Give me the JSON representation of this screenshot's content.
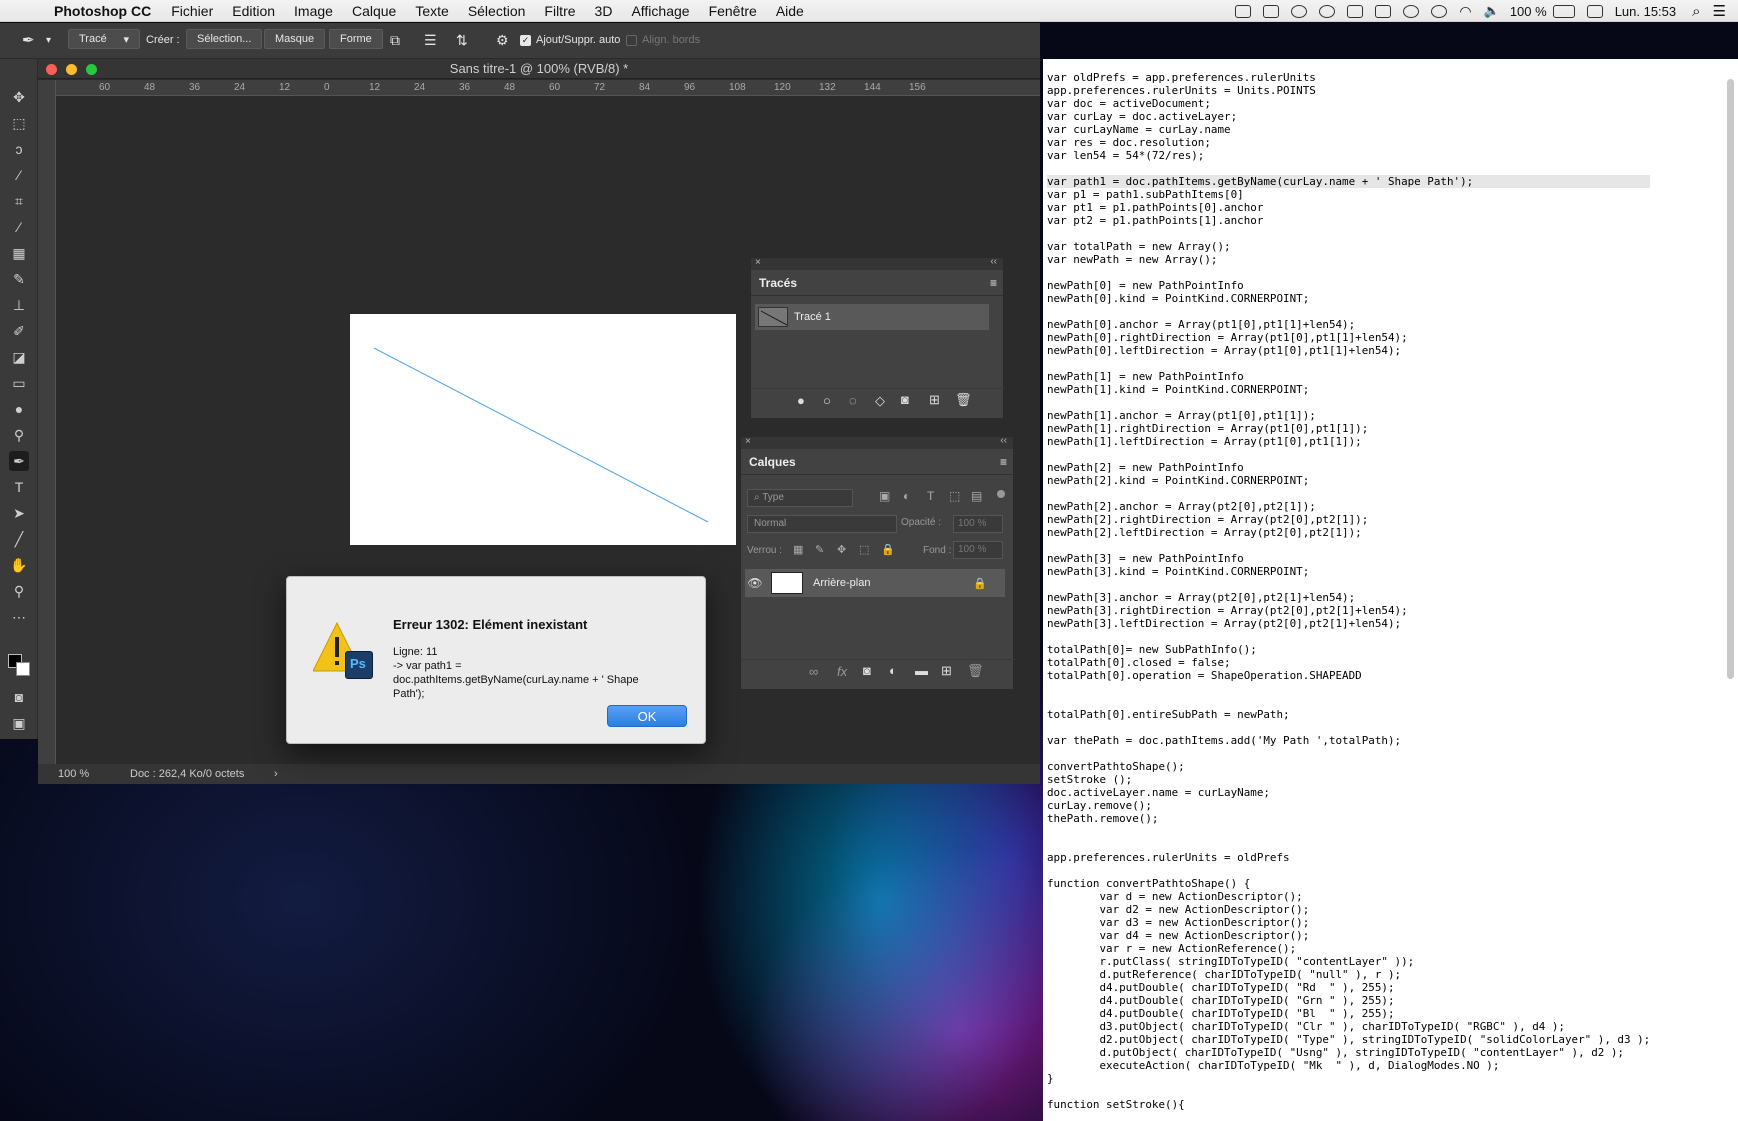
{
  "menubar": {
    "app_name": "Photoshop CC",
    "items": [
      "Fichier",
      "Edition",
      "Image",
      "Calque",
      "Texte",
      "Sélection",
      "Filtre",
      "3D",
      "Affichage",
      "Fenêtre",
      "Aide"
    ],
    "battery": "100 %",
    "clock": "Lun. 15:53"
  },
  "options_bar": {
    "mode_select": "Tracé",
    "create_label": "Créer :",
    "selection_btn": "Sélection...",
    "mask_btn": "Masque",
    "shape_btn": "Forme",
    "auto_add_label": "Ajout/Suppr. auto",
    "align_edges_label": "Align. bords"
  },
  "document": {
    "title": "Sans titre-1 @ 100% (RVB/8) *",
    "ruler_ticks": [
      "60",
      "48",
      "36",
      "24",
      "12",
      "0",
      "12",
      "24",
      "36",
      "48",
      "60",
      "72",
      "84",
      "96",
      "108",
      "120",
      "132",
      "144",
      "156"
    ],
    "status_zoom": "100 %",
    "status_doc": "Doc : 262,4 Ko/0 octets"
  },
  "paths_panel": {
    "title": "Tracés",
    "items": [
      {
        "name": "Tracé 1"
      }
    ]
  },
  "layers_panel": {
    "title": "Calques",
    "filter_placeholder": "Type",
    "blend_mode": "Normal",
    "opacity_label": "Opacité :",
    "opacity_value": "100 %",
    "lock_label": "Verrou :",
    "fill_label": "Fond :",
    "fill_value": "100 %",
    "layers": [
      {
        "name": "Arrière-plan"
      }
    ]
  },
  "dialog": {
    "title": "Erreur 1302: Elément inexistant",
    "line": "Ligne: 11",
    "message1": "-> var path1 =",
    "message2": "doc.pathItems.getByName(curLay.name + ' Shape",
    "message3": "Path');",
    "ok_label": "OK"
  },
  "editor": {
    "code_lines": [
      "var oldPrefs = app.preferences.rulerUnits",
      "app.preferences.rulerUnits = Units.POINTS",
      "var doc = activeDocument;",
      "var curLay = doc.activeLayer;",
      "var curLayName = curLay.name",
      "var res = doc.resolution;",
      "var len54 = 54*(72/res);",
      "",
      "var path1 = doc.pathItems.getByName(curLay.name + ' Shape Path');",
      "var p1 = path1.subPathItems[0]",
      "var pt1 = p1.pathPoints[0].anchor",
      "var pt2 = p1.pathPoints[1].anchor",
      "",
      "var totalPath = new Array();",
      "var newPath = new Array();",
      "",
      "newPath[0] = new PathPointInfo",
      "newPath[0].kind = PointKind.CORNERPOINT;",
      "",
      "newPath[0].anchor = Array(pt1[0],pt1[1]+len54);",
      "newPath[0].rightDirection = Array(pt1[0],pt1[1]+len54);",
      "newPath[0].leftDirection = Array(pt1[0],pt1[1]+len54);",
      "",
      "newPath[1] = new PathPointInfo",
      "newPath[1].kind = PointKind.CORNERPOINT;",
      "",
      "newPath[1].anchor = Array(pt1[0],pt1[1]);",
      "newPath[1].rightDirection = Array(pt1[0],pt1[1]);",
      "newPath[1].leftDirection = Array(pt1[0],pt1[1]);",
      "",
      "newPath[2] = new PathPointInfo",
      "newPath[2].kind = PointKind.CORNERPOINT;",
      "",
      "newPath[2].anchor = Array(pt2[0],pt2[1]);",
      "newPath[2].rightDirection = Array(pt2[0],pt2[1]);",
      "newPath[2].leftDirection = Array(pt2[0],pt2[1]);",
      "",
      "newPath[3] = new PathPointInfo",
      "newPath[3].kind = PointKind.CORNERPOINT;",
      "",
      "newPath[3].anchor = Array(pt2[0],pt2[1]+len54);",
      "newPath[3].rightDirection = Array(pt2[0],pt2[1]+len54);",
      "newPath[3].leftDirection = Array(pt2[0],pt2[1]+len54);",
      "",
      "totalPath[0]= new SubPathInfo();",
      "totalPath[0].closed = false;",
      "totalPath[0].operation = ShapeOperation.SHAPEADD",
      "",
      "",
      "totalPath[0].entireSubPath = newPath;",
      "",
      "var thePath = doc.pathItems.add('My Path ',totalPath);",
      "",
      "convertPathtoShape();",
      "setStroke ();",
      "doc.activeLayer.name = curLayName;",
      "curLay.remove();",
      "thePath.remove();",
      "",
      "",
      "app.preferences.rulerUnits = oldPrefs",
      "",
      "function convertPathtoShape() {",
      "        var d = new ActionDescriptor();",
      "        var d2 = new ActionDescriptor();",
      "        var d3 = new ActionDescriptor();",
      "        var d4 = new ActionDescriptor();",
      "        var r = new ActionReference();",
      "        r.putClass( stringIDToTypeID( \"contentLayer\" ));",
      "        d.putReference( charIDToTypeID( \"null\" ), r );",
      "        d4.putDouble( charIDToTypeID( \"Rd  \" ), 255);",
      "        d4.putDouble( charIDToTypeID( \"Grn \" ), 255);",
      "        d4.putDouble( charIDToTypeID( \"Bl  \" ), 255);",
      "        d3.putObject( charIDToTypeID( \"Clr \" ), charIDToTypeID( \"RGBC\" ), d4 );",
      "        d2.putObject( charIDToTypeID( \"Type\" ), stringIDToTypeID( \"solidColorLayer\" ), d3 );",
      "        d.putObject( charIDToTypeID( \"Usng\" ), stringIDToTypeID( \"contentLayer\" ), d2 );",
      "        executeAction( charIDToTypeID( \"Mk  \" ), d, DialogModes.NO );",
      "}",
      "",
      "function setStroke(){"
    ],
    "highlighted_line": 8
  },
  "colors": {
    "accent_blue": "#2b7fe3",
    "ps_panel": "#424242",
    "ps_dark": "#2b2b2b"
  }
}
